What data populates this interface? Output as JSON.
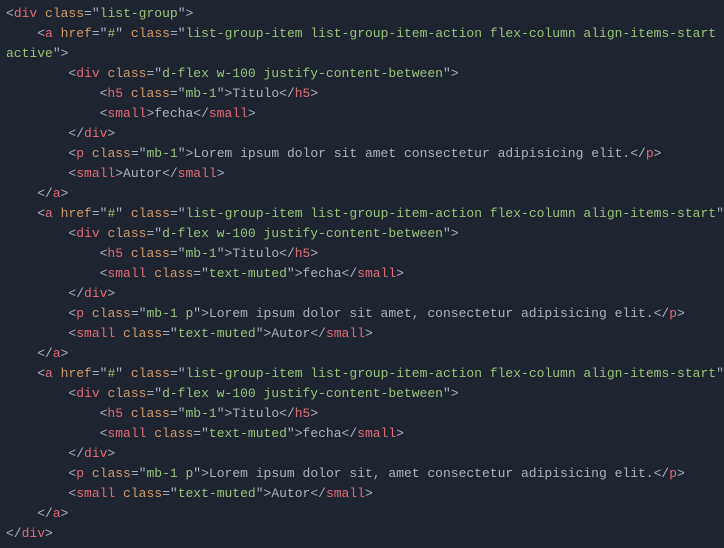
{
  "code": {
    "lines": [
      [
        {
          "c": "p",
          "t": "<"
        },
        {
          "c": "tg",
          "t": "div"
        },
        {
          "c": "p",
          "t": " "
        },
        {
          "c": "at",
          "t": "class"
        },
        {
          "c": "p",
          "t": "="
        },
        {
          "c": "p",
          "t": "\""
        },
        {
          "c": "st",
          "t": "list-group"
        },
        {
          "c": "p",
          "t": "\""
        },
        {
          "c": "p",
          "t": ">"
        }
      ],
      [
        {
          "c": "p",
          "t": "    <"
        },
        {
          "c": "tg",
          "t": "a"
        },
        {
          "c": "p",
          "t": " "
        },
        {
          "c": "at",
          "t": "href"
        },
        {
          "c": "p",
          "t": "="
        },
        {
          "c": "p",
          "t": "\""
        },
        {
          "c": "st",
          "t": "#"
        },
        {
          "c": "p",
          "t": "\""
        },
        {
          "c": "p",
          "t": " "
        },
        {
          "c": "at",
          "t": "class"
        },
        {
          "c": "p",
          "t": "="
        },
        {
          "c": "p",
          "t": "\""
        },
        {
          "c": "st",
          "t": "list-group-item list-group-item-action flex-column align-items-start "
        }
      ],
      [
        {
          "c": "st",
          "t": "active"
        },
        {
          "c": "p",
          "t": "\""
        },
        {
          "c": "p",
          "t": ">"
        }
      ],
      [
        {
          "c": "p",
          "t": "        <"
        },
        {
          "c": "tg",
          "t": "div"
        },
        {
          "c": "p",
          "t": " "
        },
        {
          "c": "at",
          "t": "class"
        },
        {
          "c": "p",
          "t": "="
        },
        {
          "c": "p",
          "t": "\""
        },
        {
          "c": "st",
          "t": "d-flex w-100 justify-content-between"
        },
        {
          "c": "p",
          "t": "\""
        },
        {
          "c": "p",
          "t": ">"
        }
      ],
      [
        {
          "c": "p",
          "t": "            <"
        },
        {
          "c": "tg",
          "t": "h5"
        },
        {
          "c": "p",
          "t": " "
        },
        {
          "c": "at",
          "t": "class"
        },
        {
          "c": "p",
          "t": "="
        },
        {
          "c": "p",
          "t": "\""
        },
        {
          "c": "st",
          "t": "mb-1"
        },
        {
          "c": "p",
          "t": "\""
        },
        {
          "c": "p",
          "t": ">"
        },
        {
          "c": "tx",
          "t": "Titulo"
        },
        {
          "c": "p",
          "t": "</"
        },
        {
          "c": "tg",
          "t": "h5"
        },
        {
          "c": "p",
          "t": ">"
        }
      ],
      [
        {
          "c": "p",
          "t": "            <"
        },
        {
          "c": "tg",
          "t": "small"
        },
        {
          "c": "p",
          "t": ">"
        },
        {
          "c": "tx",
          "t": "fecha"
        },
        {
          "c": "p",
          "t": "</"
        },
        {
          "c": "tg",
          "t": "small"
        },
        {
          "c": "p",
          "t": ">"
        }
      ],
      [
        {
          "c": "p",
          "t": "        </"
        },
        {
          "c": "tg",
          "t": "div"
        },
        {
          "c": "p",
          "t": ">"
        }
      ],
      [
        {
          "c": "p",
          "t": "        <"
        },
        {
          "c": "tg",
          "t": "p"
        },
        {
          "c": "p",
          "t": " "
        },
        {
          "c": "at",
          "t": "class"
        },
        {
          "c": "p",
          "t": "="
        },
        {
          "c": "p",
          "t": "\""
        },
        {
          "c": "st",
          "t": "mb-1"
        },
        {
          "c": "p",
          "t": "\""
        },
        {
          "c": "p",
          "t": ">"
        },
        {
          "c": "tx",
          "t": "Lorem ipsum dolor sit amet consectetur adipisicing elit."
        },
        {
          "c": "p",
          "t": "</"
        },
        {
          "c": "tg",
          "t": "p"
        },
        {
          "c": "p",
          "t": ">"
        }
      ],
      [
        {
          "c": "p",
          "t": "        <"
        },
        {
          "c": "tg",
          "t": "small"
        },
        {
          "c": "p",
          "t": ">"
        },
        {
          "c": "tx",
          "t": "Autor"
        },
        {
          "c": "p",
          "t": "</"
        },
        {
          "c": "tg",
          "t": "small"
        },
        {
          "c": "p",
          "t": ">"
        }
      ],
      [
        {
          "c": "p",
          "t": "    </"
        },
        {
          "c": "tg",
          "t": "a"
        },
        {
          "c": "p",
          "t": ">"
        }
      ],
      [
        {
          "c": "p",
          "t": "    <"
        },
        {
          "c": "tg",
          "t": "a"
        },
        {
          "c": "p",
          "t": " "
        },
        {
          "c": "at",
          "t": "href"
        },
        {
          "c": "p",
          "t": "="
        },
        {
          "c": "p",
          "t": "\""
        },
        {
          "c": "st",
          "t": "#"
        },
        {
          "c": "p",
          "t": "\""
        },
        {
          "c": "p",
          "t": " "
        },
        {
          "c": "at",
          "t": "class"
        },
        {
          "c": "p",
          "t": "="
        },
        {
          "c": "p",
          "t": "\""
        },
        {
          "c": "st",
          "t": "list-group-item list-group-item-action flex-column align-items-start"
        },
        {
          "c": "p",
          "t": "\""
        },
        {
          "c": "p",
          "t": ">"
        }
      ],
      [
        {
          "c": "p",
          "t": "        <"
        },
        {
          "c": "tg",
          "t": "div"
        },
        {
          "c": "p",
          "t": " "
        },
        {
          "c": "at",
          "t": "class"
        },
        {
          "c": "p",
          "t": "="
        },
        {
          "c": "p",
          "t": "\""
        },
        {
          "c": "st",
          "t": "d-flex w-100 justify-content-between"
        },
        {
          "c": "p",
          "t": "\""
        },
        {
          "c": "p",
          "t": ">"
        }
      ],
      [
        {
          "c": "p",
          "t": "            <"
        },
        {
          "c": "tg",
          "t": "h5"
        },
        {
          "c": "p",
          "t": " "
        },
        {
          "c": "at",
          "t": "class"
        },
        {
          "c": "p",
          "t": "="
        },
        {
          "c": "p",
          "t": "\""
        },
        {
          "c": "st",
          "t": "mb-1"
        },
        {
          "c": "p",
          "t": "\""
        },
        {
          "c": "p",
          "t": ">"
        },
        {
          "c": "tx",
          "t": "Titulo"
        },
        {
          "c": "p",
          "t": "</"
        },
        {
          "c": "tg",
          "t": "h5"
        },
        {
          "c": "p",
          "t": ">"
        }
      ],
      [
        {
          "c": "p",
          "t": "            <"
        },
        {
          "c": "tg",
          "t": "small"
        },
        {
          "c": "p",
          "t": " "
        },
        {
          "c": "at",
          "t": "class"
        },
        {
          "c": "p",
          "t": "="
        },
        {
          "c": "p",
          "t": "\""
        },
        {
          "c": "st",
          "t": "text-muted"
        },
        {
          "c": "p",
          "t": "\""
        },
        {
          "c": "p",
          "t": ">"
        },
        {
          "c": "tx",
          "t": "fecha"
        },
        {
          "c": "p",
          "t": "</"
        },
        {
          "c": "tg",
          "t": "small"
        },
        {
          "c": "p",
          "t": ">"
        }
      ],
      [
        {
          "c": "p",
          "t": "        </"
        },
        {
          "c": "tg",
          "t": "div"
        },
        {
          "c": "p",
          "t": ">"
        }
      ],
      [
        {
          "c": "p",
          "t": "        <"
        },
        {
          "c": "tg",
          "t": "p"
        },
        {
          "c": "p",
          "t": " "
        },
        {
          "c": "at",
          "t": "class"
        },
        {
          "c": "p",
          "t": "="
        },
        {
          "c": "p",
          "t": "\""
        },
        {
          "c": "st",
          "t": "mb-1 p"
        },
        {
          "c": "p",
          "t": "\""
        },
        {
          "c": "p",
          "t": ">"
        },
        {
          "c": "tx",
          "t": "Lorem ipsum dolor sit amet, consectetur adipisicing elit."
        },
        {
          "c": "p",
          "t": "</"
        },
        {
          "c": "tg",
          "t": "p"
        },
        {
          "c": "p",
          "t": ">"
        }
      ],
      [
        {
          "c": "p",
          "t": "        <"
        },
        {
          "c": "tg",
          "t": "small"
        },
        {
          "c": "p",
          "t": " "
        },
        {
          "c": "at",
          "t": "class"
        },
        {
          "c": "p",
          "t": "="
        },
        {
          "c": "p",
          "t": "\""
        },
        {
          "c": "st",
          "t": "text-muted"
        },
        {
          "c": "p",
          "t": "\""
        },
        {
          "c": "p",
          "t": ">"
        },
        {
          "c": "tx",
          "t": "Autor"
        },
        {
          "c": "p",
          "t": "</"
        },
        {
          "c": "tg",
          "t": "small"
        },
        {
          "c": "p",
          "t": ">"
        }
      ],
      [
        {
          "c": "p",
          "t": "    </"
        },
        {
          "c": "tg",
          "t": "a"
        },
        {
          "c": "p",
          "t": ">"
        }
      ],
      [
        {
          "c": "p",
          "t": "    <"
        },
        {
          "c": "tg",
          "t": "a"
        },
        {
          "c": "p",
          "t": " "
        },
        {
          "c": "at",
          "t": "href"
        },
        {
          "c": "p",
          "t": "="
        },
        {
          "c": "p",
          "t": "\""
        },
        {
          "c": "st",
          "t": "#"
        },
        {
          "c": "p",
          "t": "\""
        },
        {
          "c": "p",
          "t": " "
        },
        {
          "c": "at",
          "t": "class"
        },
        {
          "c": "p",
          "t": "="
        },
        {
          "c": "p",
          "t": "\""
        },
        {
          "c": "st",
          "t": "list-group-item list-group-item-action flex-column align-items-start"
        },
        {
          "c": "p",
          "t": "\""
        },
        {
          "c": "p",
          "t": ">"
        }
      ],
      [
        {
          "c": "p",
          "t": "        <"
        },
        {
          "c": "tg",
          "t": "div"
        },
        {
          "c": "p",
          "t": " "
        },
        {
          "c": "at",
          "t": "class"
        },
        {
          "c": "p",
          "t": "="
        },
        {
          "c": "p",
          "t": "\""
        },
        {
          "c": "st",
          "t": "d-flex w-100 justify-content-between"
        },
        {
          "c": "p",
          "t": "\""
        },
        {
          "c": "p",
          "t": ">"
        }
      ],
      [
        {
          "c": "p",
          "t": "            <"
        },
        {
          "c": "tg",
          "t": "h5"
        },
        {
          "c": "p",
          "t": " "
        },
        {
          "c": "at",
          "t": "class"
        },
        {
          "c": "p",
          "t": "="
        },
        {
          "c": "p",
          "t": "\""
        },
        {
          "c": "st",
          "t": "mb-1"
        },
        {
          "c": "p",
          "t": "\""
        },
        {
          "c": "p",
          "t": ">"
        },
        {
          "c": "tx",
          "t": "Titulo"
        },
        {
          "c": "p",
          "t": "</"
        },
        {
          "c": "tg",
          "t": "h5"
        },
        {
          "c": "p",
          "t": ">"
        }
      ],
      [
        {
          "c": "p",
          "t": "            <"
        },
        {
          "c": "tg",
          "t": "small"
        },
        {
          "c": "p",
          "t": " "
        },
        {
          "c": "at",
          "t": "class"
        },
        {
          "c": "p",
          "t": "="
        },
        {
          "c": "p",
          "t": "\""
        },
        {
          "c": "st",
          "t": "text-muted"
        },
        {
          "c": "p",
          "t": "\""
        },
        {
          "c": "p",
          "t": ">"
        },
        {
          "c": "tx",
          "t": "fecha"
        },
        {
          "c": "p",
          "t": "</"
        },
        {
          "c": "tg",
          "t": "small"
        },
        {
          "c": "p",
          "t": ">"
        }
      ],
      [
        {
          "c": "p",
          "t": "        </"
        },
        {
          "c": "tg",
          "t": "div"
        },
        {
          "c": "p",
          "t": ">"
        }
      ],
      [
        {
          "c": "p",
          "t": "        <"
        },
        {
          "c": "tg",
          "t": "p"
        },
        {
          "c": "p",
          "t": " "
        },
        {
          "c": "at",
          "t": "class"
        },
        {
          "c": "p",
          "t": "="
        },
        {
          "c": "p",
          "t": "\""
        },
        {
          "c": "st",
          "t": "mb-1 p"
        },
        {
          "c": "p",
          "t": "\""
        },
        {
          "c": "p",
          "t": ">"
        },
        {
          "c": "tx",
          "t": "Lorem ipsum dolor sit, amet consectetur adipisicing elit."
        },
        {
          "c": "p",
          "t": "</"
        },
        {
          "c": "tg",
          "t": "p"
        },
        {
          "c": "p",
          "t": ">"
        }
      ],
      [
        {
          "c": "p",
          "t": "        <"
        },
        {
          "c": "tg",
          "t": "small"
        },
        {
          "c": "p",
          "t": " "
        },
        {
          "c": "at",
          "t": "class"
        },
        {
          "c": "p",
          "t": "="
        },
        {
          "c": "p",
          "t": "\""
        },
        {
          "c": "st",
          "t": "text-muted"
        },
        {
          "c": "p",
          "t": "\""
        },
        {
          "c": "p",
          "t": ">"
        },
        {
          "c": "tx",
          "t": "Autor"
        },
        {
          "c": "p",
          "t": "</"
        },
        {
          "c": "tg",
          "t": "small"
        },
        {
          "c": "p",
          "t": ">"
        }
      ],
      [
        {
          "c": "p",
          "t": "    </"
        },
        {
          "c": "tg",
          "t": "a"
        },
        {
          "c": "p",
          "t": ">"
        }
      ],
      [
        {
          "c": "p",
          "t": "</"
        },
        {
          "c": "tg",
          "t": "div"
        },
        {
          "c": "p",
          "t": ">"
        }
      ]
    ]
  }
}
